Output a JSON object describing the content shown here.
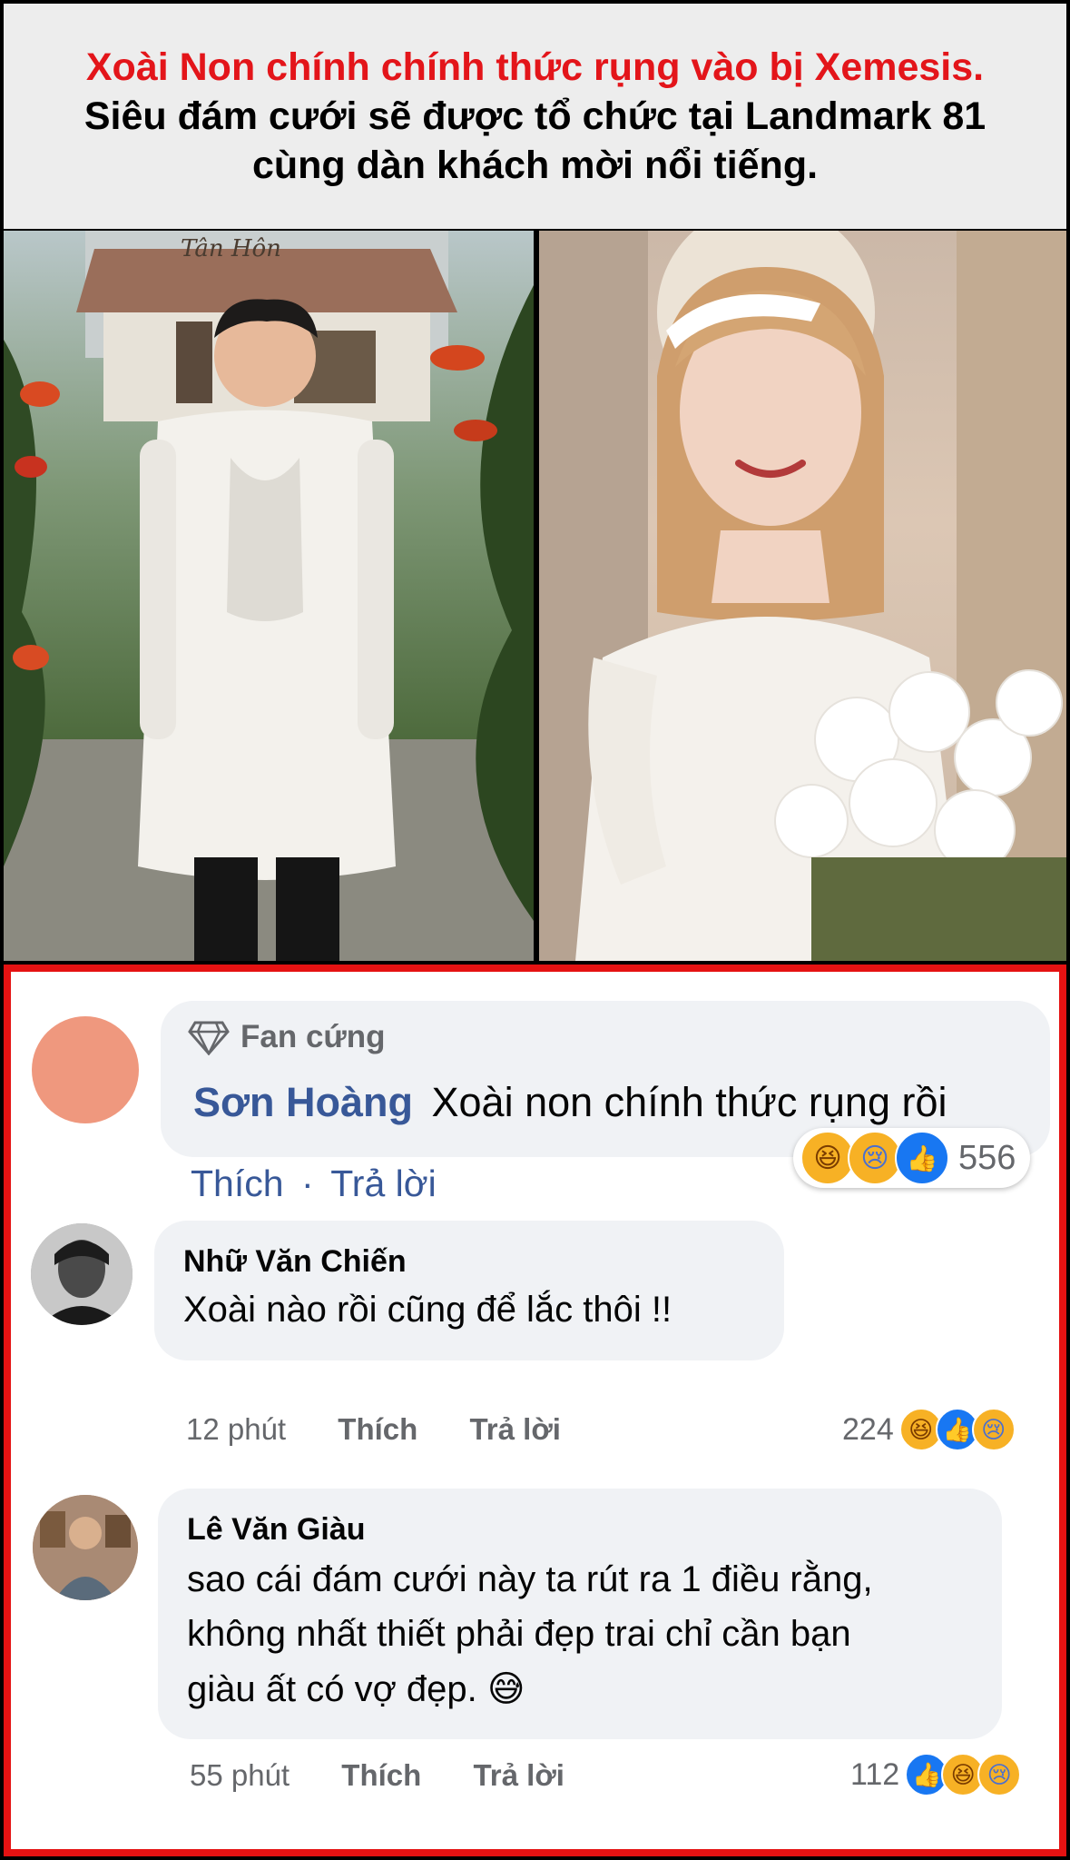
{
  "header": {
    "line1": "Xoài Non chính chính thức rụng vào bị Xemesis.",
    "line2": "Siêu đám cưới sẽ được tổ chức tại Landmark 81",
    "line3": "cùng dàn khách mời nổi tiếng."
  },
  "photos": {
    "left_sign": "Tân Hôn"
  },
  "comments": [
    {
      "badge": "Fan cứng",
      "author": "Sơn Hoàng",
      "text": "Xoài non chính thức rụng rồi",
      "like": "Thích",
      "separator": "·",
      "reply": "Trả lời",
      "reaction_count": "556",
      "reactions": [
        "haha",
        "sad",
        "like"
      ]
    },
    {
      "author": "Nhữ Văn Chiến",
      "text": "Xoài nào rồi cũng để lắc thôi !!",
      "time": "12 phút",
      "like": "Thích",
      "reply": "Trả lời",
      "reaction_count": "224",
      "reactions": [
        "haha",
        "like",
        "sad"
      ]
    },
    {
      "author": "Lê Văn Giàu",
      "text_lines": [
        "sao cái đám cưới này ta rút ra 1 điều rằng,",
        "không nhất thiết phải đẹp trai chỉ cần bạn",
        "giàu ất có vợ đẹp. 😅"
      ],
      "time": "55 phút",
      "like": "Thích",
      "reply": "Trả lời",
      "reaction_count": "112",
      "reactions": [
        "like",
        "haha",
        "sad"
      ]
    }
  ],
  "colors": {
    "headline_red": "#e3151a",
    "frame_red": "#e51212",
    "link_blue": "#385898",
    "meta_gray": "#65676b",
    "bubble_gray": "#f0f2f5"
  }
}
